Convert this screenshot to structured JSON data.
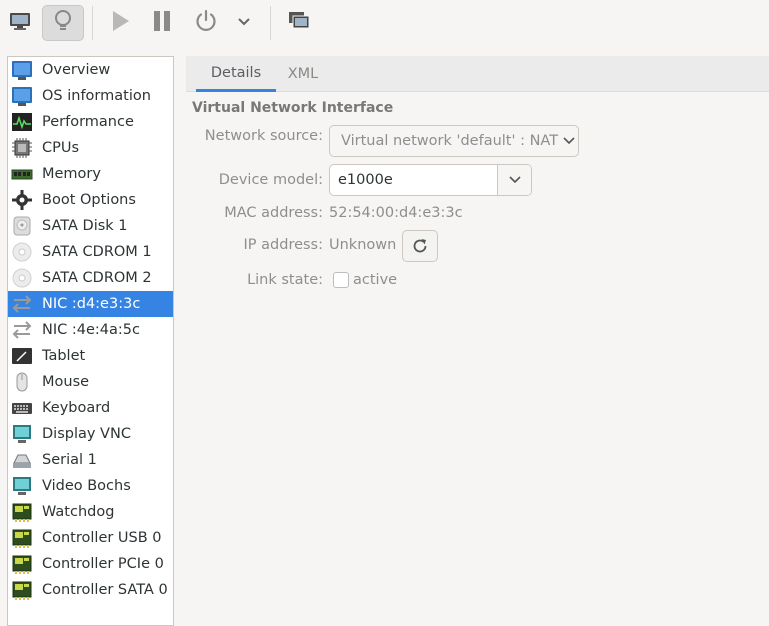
{
  "toolbar": {
    "buttons": [
      "monitor-icon",
      "lightbulb-icon",
      "play-icon",
      "pause-icon",
      "power-icon",
      "chevron-down-icon",
      "screenshot-icon"
    ]
  },
  "sidebar": {
    "items": [
      {
        "label": "Overview",
        "icon": "overview-icon"
      },
      {
        "label": "OS information",
        "icon": "os-info-icon"
      },
      {
        "label": "Performance",
        "icon": "performance-icon"
      },
      {
        "label": "CPUs",
        "icon": "cpu-icon"
      },
      {
        "label": "Memory",
        "icon": "memory-icon"
      },
      {
        "label": "Boot Options",
        "icon": "gear-icon"
      },
      {
        "label": "SATA Disk 1",
        "icon": "disk-icon"
      },
      {
        "label": "SATA CDROM 1",
        "icon": "cdrom-icon"
      },
      {
        "label": "SATA CDROM 2",
        "icon": "cdrom-icon"
      },
      {
        "label": "NIC :d4:e3:3c",
        "icon": "network-icon",
        "selected": true
      },
      {
        "label": "NIC :4e:4a:5c",
        "icon": "network-icon"
      },
      {
        "label": "Tablet",
        "icon": "tablet-icon"
      },
      {
        "label": "Mouse",
        "icon": "mouse-icon"
      },
      {
        "label": "Keyboard",
        "icon": "keyboard-icon"
      },
      {
        "label": "Display VNC",
        "icon": "display-icon"
      },
      {
        "label": "Serial 1",
        "icon": "serial-icon"
      },
      {
        "label": "Video Bochs",
        "icon": "video-icon"
      },
      {
        "label": "Watchdog",
        "icon": "card-icon"
      },
      {
        "label": "Controller USB 0",
        "icon": "card-icon"
      },
      {
        "label": "Controller PCIe 0",
        "icon": "card-icon"
      },
      {
        "label": "Controller SATA 0",
        "icon": "card-icon"
      }
    ]
  },
  "tabs": {
    "details": "Details",
    "xml": "XML"
  },
  "details": {
    "section_title": "Virtual Network Interface",
    "network_source_label": "Network source:",
    "network_source_value": "Virtual network 'default' : NAT",
    "device_model_label": "Device model:",
    "device_model_value": "e1000e",
    "mac_label": "MAC address:",
    "mac_value": "52:54:00:d4:e3:3c",
    "ip_label": "IP address:",
    "ip_value": "Unknown",
    "link_label": "Link state:",
    "link_value": "active",
    "link_checked": false
  },
  "colors": {
    "accent": "#3584e4",
    "selected_text": "#ffffff"
  }
}
